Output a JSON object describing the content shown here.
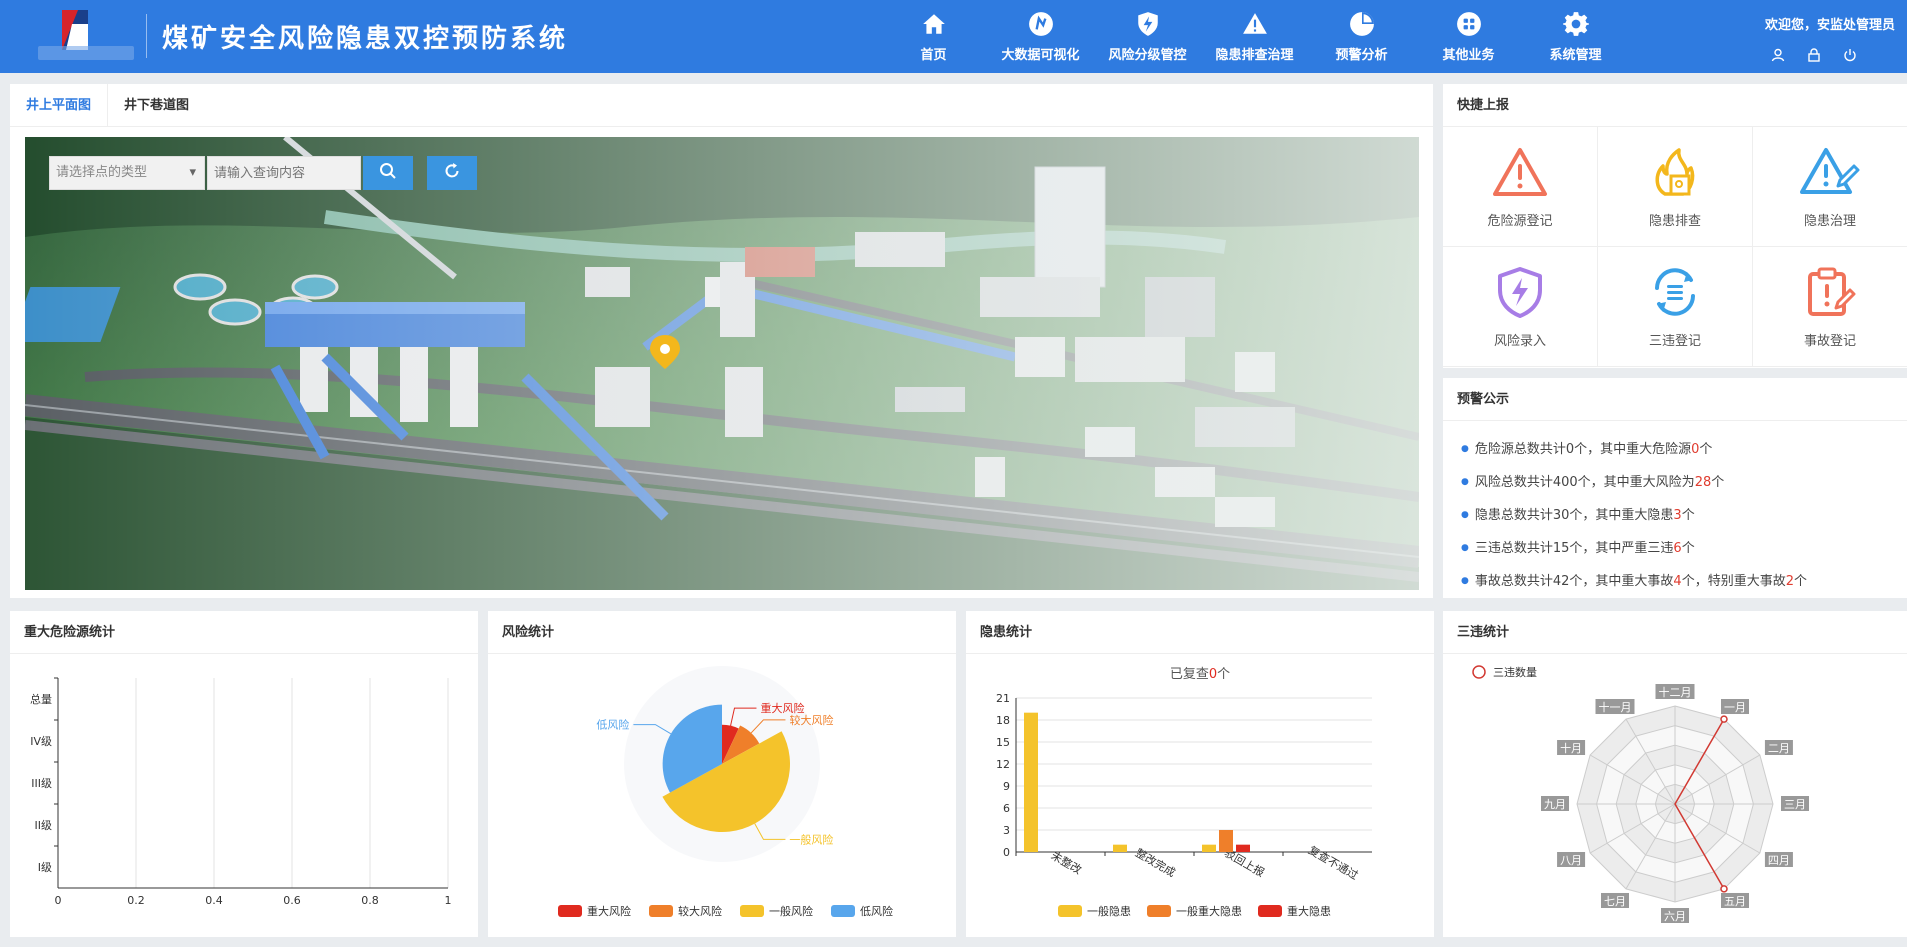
{
  "header": {
    "title": "煤矿安全风险隐患双控预防系统",
    "nav": [
      {
        "label": "首页",
        "icon": "home-icon"
      },
      {
        "label": "大数据可视化",
        "icon": "compass-icon"
      },
      {
        "label": "风险分级管控",
        "icon": "shield-bolt-icon"
      },
      {
        "label": "隐患排查治理",
        "icon": "warning-wrench-icon"
      },
      {
        "label": "预警分析",
        "icon": "pie-chart-icon"
      },
      {
        "label": "其他业务",
        "icon": "grid-icon"
      },
      {
        "label": "系统管理",
        "icon": "gear-icon"
      }
    ],
    "welcome": "欢迎您，安监处管理员",
    "user_icons": [
      "user-icon",
      "lock-icon",
      "power-icon"
    ]
  },
  "map": {
    "tabs": [
      "井上平面图",
      "井下巷道图"
    ],
    "select_placeholder": "请选择点的类型",
    "input_placeholder": "请输入查询内容"
  },
  "quick": {
    "title": "快捷上报",
    "items": [
      {
        "label": "危险源登记",
        "icon": "hazard-triangle-icon",
        "color": "#f0735a"
      },
      {
        "label": "隐患排查",
        "icon": "fire-doc-icon",
        "color": "#f3b71c"
      },
      {
        "label": "隐患治理",
        "icon": "warning-pen-icon",
        "color": "#3aa0e6"
      },
      {
        "label": "风险录入",
        "icon": "shield-bolt-icon",
        "color": "#a77de6"
      },
      {
        "label": "三违登记",
        "icon": "refresh-list-icon",
        "color": "#3aa0e6"
      },
      {
        "label": "事故登记",
        "icon": "clipboard-alert-icon",
        "color": "#f0735a"
      }
    ]
  },
  "warn": {
    "title": "预警公示",
    "items": [
      {
        "a": "危险源总数共计0个，其中重大危险源",
        "b": "0",
        "c": "个",
        "d": "",
        "e": "",
        "f": ""
      },
      {
        "a": "风险总数共计400个，其中重大风险为",
        "b": "28",
        "c": "个",
        "d": "",
        "e": "",
        "f": ""
      },
      {
        "a": "隐患总数共计30个，其中重大隐患",
        "b": "3",
        "c": "个",
        "d": "",
        "e": "",
        "f": ""
      },
      {
        "a": "三违总数共计15个，其中严重三违",
        "b": "6",
        "c": "个",
        "d": "",
        "e": "",
        "f": ""
      },
      {
        "a": "事故总数共计42个，其中重大事故",
        "b": "4",
        "c": "个，特别重大事故",
        "d": "2",
        "e": "个",
        "f": ""
      }
    ]
  },
  "colors": {
    "header_bg": "#2f7be0",
    "red": "#e02a1f",
    "orange": "#ef7f2a",
    "yellow": "#f4c32b",
    "blue": "#58a6ec"
  },
  "chart_data": [
    {
      "type": "bar",
      "title": "重大危险源统计",
      "orientation": "horizontal",
      "categories": [
        "总量",
        "IV级",
        "III级",
        "II级",
        "I级"
      ],
      "values": [
        0,
        0,
        0,
        0,
        0
      ],
      "xlim": [
        0,
        1
      ],
      "xticks": [
        "0",
        "0.2",
        "0.4",
        "0.6",
        "0.8",
        "1"
      ],
      "grid": true
    },
    {
      "type": "pie",
      "title": "风险统计",
      "rose": true,
      "legend_position": "bottom",
      "series": [
        {
          "name": "重大风险",
          "value": 28,
          "color": "#e02a1f"
        },
        {
          "name": "较大风险",
          "value": 40,
          "color": "#ef7f2a"
        },
        {
          "name": "一般风险",
          "value": 200,
          "color": "#f4c32b"
        },
        {
          "name": "低风险",
          "value": 132,
          "color": "#58a6ec"
        }
      ]
    },
    {
      "type": "bar",
      "title": "隐患统计",
      "subtitle_a": "已复查",
      "subtitle_b": "0",
      "subtitle_c": "个",
      "categories": [
        "未整改",
        "整改完成",
        "驳回上报",
        "复查不通过"
      ],
      "ylim": [
        0,
        21
      ],
      "yticks": [
        "0",
        "3",
        "6",
        "9",
        "12",
        "15",
        "18",
        "21"
      ],
      "legend_position": "bottom",
      "series": [
        {
          "name": "一般隐患",
          "values": [
            19,
            1,
            1,
            0
          ],
          "color": "#f4c32b"
        },
        {
          "name": "一般重大隐患",
          "values": [
            0,
            0,
            3,
            0
          ],
          "color": "#ef7f2a"
        },
        {
          "name": "重大隐患",
          "values": [
            0,
            0,
            1,
            0
          ],
          "color": "#e02a1f"
        }
      ]
    },
    {
      "type": "radar",
      "title": "三违统计",
      "legend": "三违数量",
      "legend_position": "top-left",
      "axes": [
        "十二月",
        "一月",
        "二月",
        "三月",
        "四月",
        "五月",
        "六月",
        "七月",
        "八月",
        "九月",
        "十月",
        "十一月"
      ],
      "values": [
        0,
        9,
        0,
        0,
        0,
        9,
        0,
        0,
        0,
        0,
        0,
        0
      ],
      "max": 9,
      "color": "#d23a33"
    }
  ]
}
